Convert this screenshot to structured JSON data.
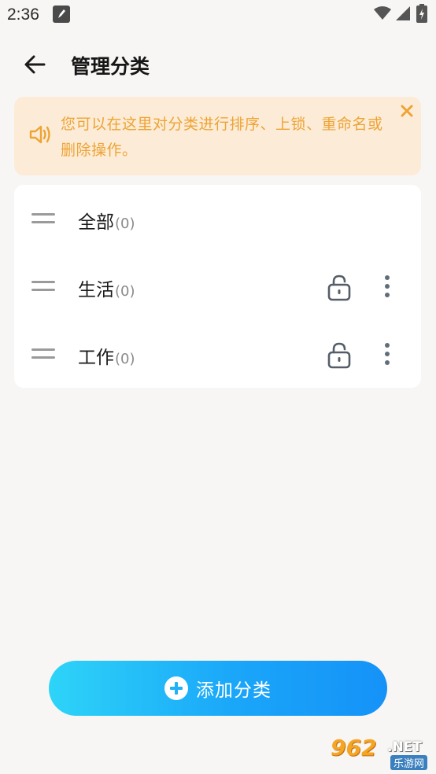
{
  "status_bar": {
    "time": "2:36"
  },
  "header": {
    "title": "管理分类"
  },
  "notice": {
    "text": "您可以在这里对分类进行排序、上锁、重命名或删除操作。",
    "text_color": "#eea334",
    "background": "#fcecd7"
  },
  "categories": [
    {
      "name": "全部",
      "count": "(0)",
      "lock": false,
      "more": false
    },
    {
      "name": "生活",
      "count": "(0)",
      "lock": true,
      "more": true
    },
    {
      "name": "工作",
      "count": "(0)",
      "lock": true,
      "more": true
    }
  ],
  "add_button": {
    "label": "添加分类"
  },
  "watermark": {
    "main": "962",
    "net": ".NET",
    "sub": "乐游网"
  },
  "colors": {
    "accent_start": "#2ed4f8",
    "accent_end": "#1592f8",
    "page_bg": "#f8f6f4"
  }
}
